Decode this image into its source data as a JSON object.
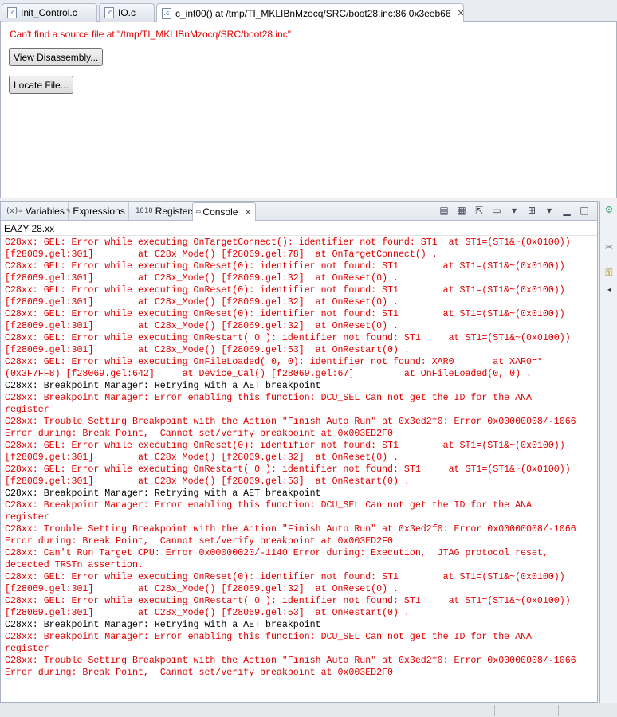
{
  "editor_tabs": [
    {
      "label": "Init_Control.c",
      "icon": "c-file-icon"
    },
    {
      "label": "IO.c",
      "icon": "c-file-icon"
    },
    {
      "label": "c_int00() at /tmp/TI_MKLIBnMzocq/SRC/boot28.inc:86 0x3eeb66",
      "icon": "c-file-icon"
    }
  ],
  "editor": {
    "error_message": "Can't find a source file at \"/tmp/TI_MKLIBnMzocq/SRC/boot28.inc\"",
    "view_disassembly_label": "View Disassembly...",
    "locate_file_label": "Locate File..."
  },
  "view_tabs": [
    {
      "label": "Variables",
      "icon": "variables-icon",
      "glyph": "(x)="
    },
    {
      "label": "Expressions",
      "icon": "expressions-icon",
      "glyph": "✎"
    },
    {
      "label": "Registers",
      "icon": "registers-icon",
      "glyph": "1010"
    },
    {
      "label": "Console",
      "icon": "console-icon",
      "glyph": "▭"
    }
  ],
  "console": {
    "title": "EAZY 28.xx",
    "lines": [
      {
        "text": "C28xx: GEL: Error while executing OnTargetConnect(): identifier not found: ST1  at ST1=(ST1&~(0x0100))",
        "type": "err"
      },
      {
        "text": "[f28069.gel:301]        at C28x_Mode() [f28069.gel:78]  at OnTargetConnect() .",
        "type": "err"
      },
      {
        "text": "C28xx: GEL: Error while executing OnReset(0): identifier not found: ST1        at ST1=(ST1&~(0x0100))",
        "type": "err"
      },
      {
        "text": "[f28069.gel:301]        at C28x_Mode() [f28069.gel:32]  at OnReset(0) .",
        "type": "err"
      },
      {
        "text": "C28xx: GEL: Error while executing OnReset(0): identifier not found: ST1        at ST1=(ST1&~(0x0100))",
        "type": "err"
      },
      {
        "text": "[f28069.gel:301]        at C28x_Mode() [f28069.gel:32]  at OnReset(0) .",
        "type": "err"
      },
      {
        "text": "C28xx: GEL: Error while executing OnReset(0): identifier not found: ST1        at ST1=(ST1&~(0x0100))",
        "type": "err"
      },
      {
        "text": "[f28069.gel:301]        at C28x_Mode() [f28069.gel:32]  at OnReset(0) .",
        "type": "err"
      },
      {
        "text": "C28xx: GEL: Error while executing OnRestart( 0 ): identifier not found: ST1     at ST1=(ST1&~(0x0100))",
        "type": "err"
      },
      {
        "text": "[f28069.gel:301]        at C28x_Mode() [f28069.gel:53]  at OnRestart(0) .",
        "type": "err"
      },
      {
        "text": "C28xx: GEL: Error while executing OnFileLoaded( 0, 0): identifier not found: XAR0       at XAR0=*",
        "type": "err"
      },
      {
        "text": "(0x3F7FF8) [f28069.gel:642]     at Device_Cal() [f28069.gel:67]         at OnFileLoaded(0, 0) .",
        "type": "err"
      },
      {
        "text": "C28xx: Breakpoint Manager: Retrying with a AET breakpoint",
        "type": "info"
      },
      {
        "text": "C28xx: Breakpoint Manager: Error enabling this function: DCU_SEL Can not get the ID for the ANA",
        "type": "err"
      },
      {
        "text": "register",
        "type": "err"
      },
      {
        "text": "C28xx: Trouble Setting Breakpoint with the Action \"Finish Auto Run\" at 0x3ed2f0: Error 0x00000008/-1066",
        "type": "err"
      },
      {
        "text": "Error during: Break Point,  Cannot set/verify breakpoint at 0x003ED2F0",
        "type": "err"
      },
      {
        "text": "C28xx: GEL: Error while executing OnReset(0): identifier not found: ST1        at ST1=(ST1&~(0x0100))",
        "type": "err"
      },
      {
        "text": "[f28069.gel:301]        at C28x_Mode() [f28069.gel:32]  at OnReset(0) .",
        "type": "err"
      },
      {
        "text": "C28xx: GEL: Error while executing OnRestart( 0 ): identifier not found: ST1     at ST1=(ST1&~(0x0100))",
        "type": "err"
      },
      {
        "text": "[f28069.gel:301]        at C28x_Mode() [f28069.gel:53]  at OnRestart(0) .",
        "type": "err"
      },
      {
        "text": "C28xx: Breakpoint Manager: Retrying with a AET breakpoint",
        "type": "info"
      },
      {
        "text": "C28xx: Breakpoint Manager: Error enabling this function: DCU_SEL Can not get the ID for the ANA",
        "type": "err"
      },
      {
        "text": "register",
        "type": "err"
      },
      {
        "text": "C28xx: Trouble Setting Breakpoint with the Action \"Finish Auto Run\" at 0x3ed2f0: Error 0x00000008/-1066",
        "type": "err"
      },
      {
        "text": "Error during: Break Point,  Cannot set/verify breakpoint at 0x003ED2F0",
        "type": "err"
      },
      {
        "text": "C28xx: Can't Run Target CPU: Error 0x00000020/-1140 Error during: Execution,  JTAG protocol reset,",
        "type": "err"
      },
      {
        "text": "detected TRSTn assertion.",
        "type": "err"
      },
      {
        "text": "C28xx: GEL: Error while executing OnReset(0): identifier not found: ST1        at ST1=(ST1&~(0x0100))",
        "type": "err"
      },
      {
        "text": "[f28069.gel:301]        at C28x_Mode() [f28069.gel:32]  at OnReset(0) .",
        "type": "err"
      },
      {
        "text": "C28xx: GEL: Error while executing OnRestart( 0 ): identifier not found: ST1     at ST1=(ST1&~(0x0100))",
        "type": "err"
      },
      {
        "text": "[f28069.gel:301]        at C28x_Mode() [f28069.gel:53]  at OnRestart(0) .",
        "type": "err"
      },
      {
        "text": "C28xx: Breakpoint Manager: Retrying with a AET breakpoint",
        "type": "info"
      },
      {
        "text": "C28xx: Breakpoint Manager: Error enabling this function: DCU_SEL Can not get the ID for the ANA",
        "type": "err"
      },
      {
        "text": "register",
        "type": "err"
      },
      {
        "text": "C28xx: Trouble Setting Breakpoint with the Action \"Finish Auto Run\" at 0x3ed2f0: Error 0x00000008/-1066",
        "type": "err"
      },
      {
        "text": "Error during: Break Point,  Cannot set/verify breakpoint at 0x003ED2F0",
        "type": "err"
      }
    ]
  },
  "colors": {
    "error": "#e00000",
    "info": "#000000"
  }
}
